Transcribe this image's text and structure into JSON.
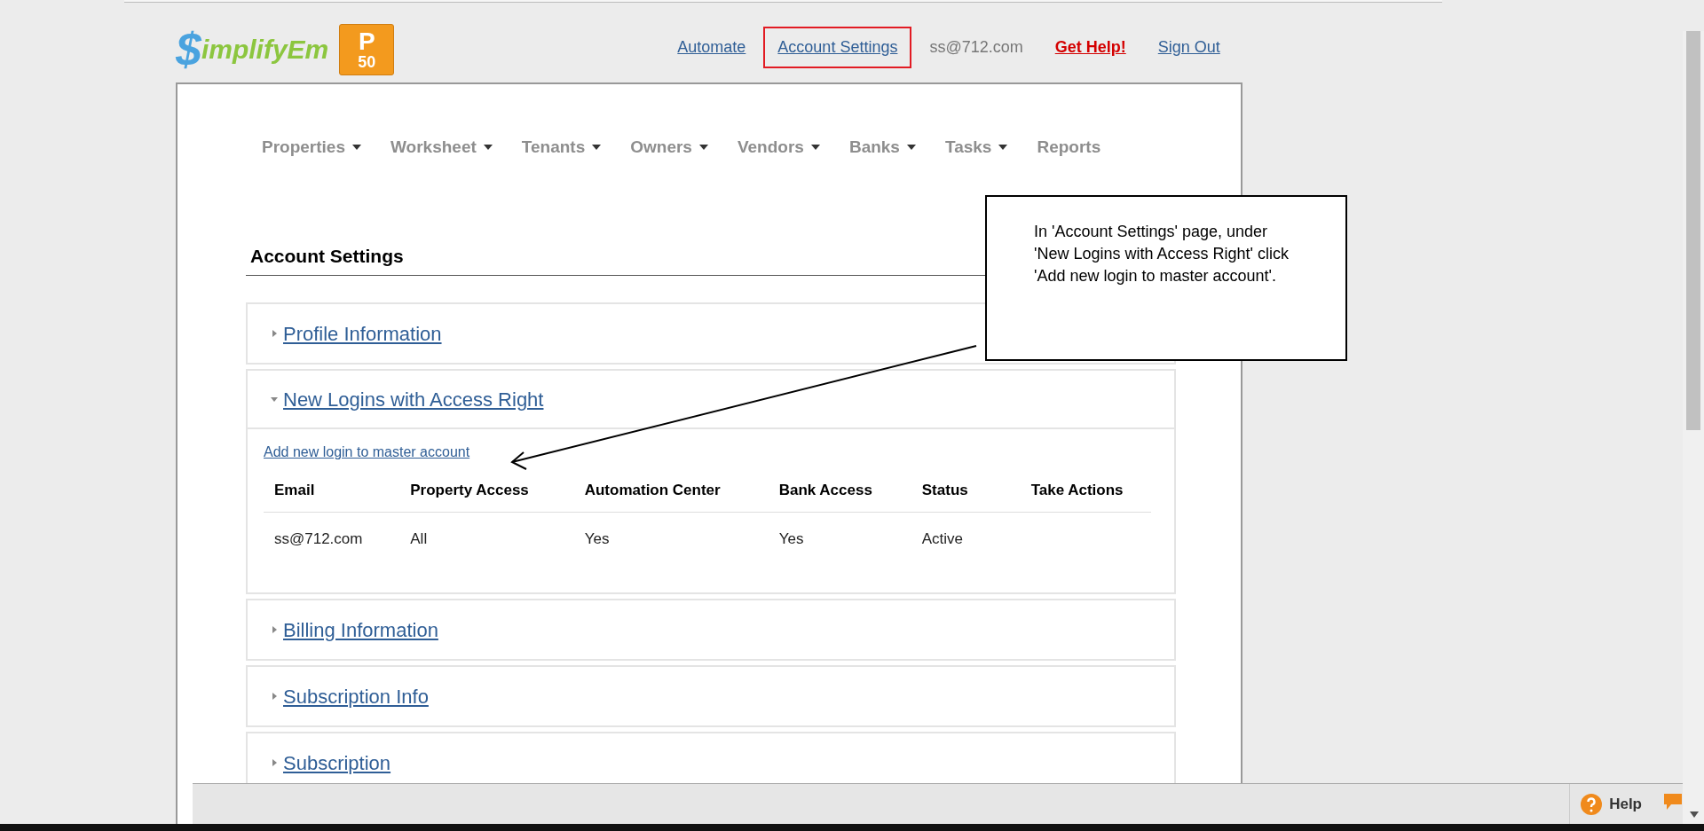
{
  "logo": {
    "mark": "$",
    "text": "implifyEm",
    "badge_letter": "P",
    "badge_number": "50"
  },
  "header_links": [
    {
      "label": "Automate",
      "kind": "link",
      "highlighted": false
    },
    {
      "label": "Account Settings",
      "kind": "link",
      "highlighted": true
    },
    {
      "label": "ss@712.com",
      "kind": "plain",
      "highlighted": false
    },
    {
      "label": "Get Help!",
      "kind": "help",
      "highlighted": false
    },
    {
      "label": "Sign Out",
      "kind": "link",
      "highlighted": false
    }
  ],
  "menu": [
    {
      "label": "Properties",
      "has_dropdown": true
    },
    {
      "label": "Worksheet",
      "has_dropdown": true
    },
    {
      "label": "Tenants",
      "has_dropdown": true
    },
    {
      "label": "Owners",
      "has_dropdown": true
    },
    {
      "label": "Vendors",
      "has_dropdown": true
    },
    {
      "label": "Banks",
      "has_dropdown": true
    },
    {
      "label": "Tasks",
      "has_dropdown": true
    },
    {
      "label": "Reports",
      "has_dropdown": false
    }
  ],
  "page_title": "Account Settings",
  "sections": [
    {
      "title": "Profile Information",
      "expanded": false
    },
    {
      "title": "New Logins with Access Right",
      "expanded": true,
      "link": "Add new login to master account",
      "table": {
        "columns": [
          "Email",
          "Property Access",
          "Automation Center",
          "Bank Access",
          "Status",
          "Take Actions"
        ],
        "rows": [
          [
            "ss@712.com",
            "All",
            "Yes",
            "Yes",
            "Active",
            ""
          ]
        ]
      }
    },
    {
      "title": "Billing Information",
      "expanded": false
    },
    {
      "title": "Subscription Info",
      "expanded": false
    },
    {
      "title": "Subscription",
      "expanded": false
    }
  ],
  "callout": {
    "text": "In 'Account Settings' page, under 'New Logins with Access Right' click 'Add new login to master account'."
  },
  "footer": {
    "help_label": "Help"
  }
}
